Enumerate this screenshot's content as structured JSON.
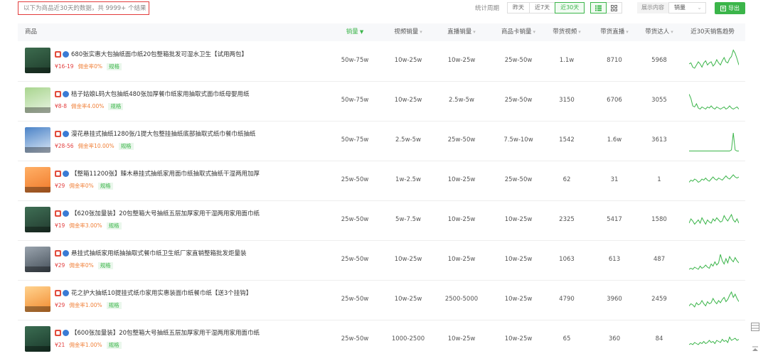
{
  "toolbar": {
    "summary": "以下为商品近30天的数据，共 9999+ 个结果",
    "period_label": "统计周期",
    "periods": [
      "昨天",
      "近7天",
      "近30天"
    ],
    "display_label": "展示内容",
    "display_value": "销量",
    "export_label": "导出",
    "accent": "#3bb54a"
  },
  "table": {
    "headers": {
      "product": "商品",
      "sales": "销量",
      "video_sales": "视频销量",
      "live_sales": "直播销量",
      "card_sales": "商品卡销量",
      "videos": "带货视频",
      "lives": "带货直播",
      "influencers": "带货达人",
      "trend": "近30天销售趋势"
    },
    "rows": [
      {
        "title": "680张实惠大包抽纸面巾纸20包整箱批发可湿水卫生【试用两包】",
        "price": "¥16-19",
        "commission": "佣金率0%",
        "spec": "规格",
        "sales": "50w-75w",
        "video_sales": "10w-25w",
        "live_sales": "10w-25w",
        "card_sales": "25w-50w",
        "videos": "1.1w",
        "lives": "8710",
        "influencers": "5968",
        "trend": [
          20,
          22,
          14,
          12,
          18,
          24,
          20,
          14,
          22,
          26,
          18,
          22,
          24,
          16,
          20,
          28,
          22,
          18,
          26,
          32,
          24,
          22,
          30,
          34,
          46,
          40,
          30,
          18
        ]
      },
      {
        "title": "桔子姑娘L码大包抽纸480张加厚餐巾纸家用抽取式面巾纸母婴用纸",
        "price": "¥8-8",
        "commission": "佣金率4.00%",
        "spec": "规格",
        "sales": "50w-75w",
        "video_sales": "10w-25w",
        "live_sales": "2.5w-5w",
        "card_sales": "25w-50w",
        "videos": "3150",
        "lives": "6706",
        "influencers": "3055",
        "trend": [
          38,
          30,
          16,
          14,
          20,
          12,
          10,
          14,
          12,
          10,
          14,
          12,
          16,
          12,
          10,
          14,
          12,
          10,
          12,
          14,
          10,
          12,
          16,
          12,
          10,
          12,
          14,
          10
        ]
      },
      {
        "title": "漫花悬挂式抽纸1280张/1提大包整挂抽纸底部抽取式纸巾餐巾纸抽纸",
        "price": "¥28-56",
        "commission": "佣金率10.00%",
        "spec": "规格",
        "sales": "50w-75w",
        "video_sales": "2.5w-5w",
        "live_sales": "25w-50w",
        "card_sales": "7.5w-10w",
        "videos": "1542",
        "lives": "1.6w",
        "influencers": "3613",
        "trend": [
          6,
          6,
          6,
          6,
          6,
          6,
          6,
          6,
          6,
          6,
          6,
          6,
          6,
          6,
          6,
          6,
          6,
          6,
          6,
          6,
          6,
          6,
          6,
          8,
          40,
          8,
          6,
          6
        ]
      },
      {
        "title": "【整箱11200张】臻木悬挂式抽纸家用面巾纸抽取式抽纸干湿两用加厚",
        "price": "¥29",
        "commission": "佣金率0%",
        "spec": "规格",
        "sales": "25w-50w",
        "video_sales": "1w-2.5w",
        "live_sales": "10w-25w",
        "card_sales": "25w-50w",
        "videos": "62",
        "lives": "31",
        "influencers": "1",
        "trend": [
          22,
          26,
          24,
          28,
          26,
          22,
          24,
          28,
          26,
          30,
          26,
          24,
          28,
          32,
          28,
          26,
          30,
          28,
          26,
          30,
          34,
          30,
          28,
          32,
          36,
          32,
          30,
          32
        ]
      },
      {
        "title": "【620张加量装】20包整箱大号抽纸五层加厚家用干湿两用家用面巾纸",
        "price": "¥19",
        "commission": "佣金率3.00%",
        "spec": "规格",
        "sales": "25w-50w",
        "video_sales": "5w-7.5w",
        "live_sales": "10w-25w",
        "card_sales": "10w-25w",
        "videos": "2325",
        "lives": "5417",
        "influencers": "1580",
        "trend": [
          20,
          28,
          24,
          18,
          22,
          26,
          20,
          30,
          24,
          18,
          26,
          22,
          20,
          28,
          24,
          30,
          26,
          22,
          24,
          34,
          28,
          24,
          30,
          36,
          26,
          22,
          28,
          20
        ]
      },
      {
        "title": "悬挂式抽纸家用纸抽抽取式餐巾纸卫生纸厂家直销整箱批发炬量装",
        "price": "¥29",
        "commission": "佣金率0%",
        "spec": "规格",
        "sales": "25w-50w",
        "video_sales": "10w-25w",
        "live_sales": "10w-25w",
        "card_sales": "10w-25w",
        "videos": "1063",
        "lives": "613",
        "influencers": "487",
        "trend": [
          8,
          10,
          8,
          12,
          10,
          8,
          14,
          10,
          12,
          16,
          12,
          10,
          18,
          14,
          22,
          16,
          20,
          36,
          24,
          18,
          28,
          20,
          32,
          26,
          22,
          30,
          24,
          20
        ]
      },
      {
        "title": "花之护大抽纸10提挂式纸巾家用实惠装面巾纸餐巾纸【送3个挂钩】",
        "price": "¥29",
        "commission": "佣金率1.00%",
        "spec": "规格",
        "sales": "25w-50w",
        "video_sales": "10w-25w",
        "live_sales": "2500-5000",
        "card_sales": "10w-25w",
        "videos": "4790",
        "lives": "3960",
        "influencers": "2459",
        "trend": [
          14,
          18,
          16,
          12,
          20,
          16,
          18,
          24,
          18,
          14,
          22,
          18,
          20,
          28,
          22,
          18,
          24,
          20,
          26,
          30,
          22,
          26,
          34,
          40,
          30,
          36,
          28,
          22
        ]
      },
      {
        "title": "【600张加量装】20包整箱大号抽纸五层加厚家用干湿两用家用面巾纸",
        "price": "¥21",
        "commission": "佣金率1.00%",
        "spec": "规格",
        "sales": "25w-50w",
        "video_sales": "1000-2500",
        "live_sales": "10w-25w",
        "card_sales": "10w-25w",
        "videos": "65",
        "lives": "360",
        "influencers": "84",
        "trend": [
          16,
          18,
          16,
          20,
          18,
          16,
          20,
          18,
          22,
          18,
          20,
          24,
          20,
          22,
          18,
          24,
          22,
          20,
          26,
          22,
          24,
          20,
          30,
          24,
          26,
          28,
          24,
          26
        ]
      }
    ]
  }
}
